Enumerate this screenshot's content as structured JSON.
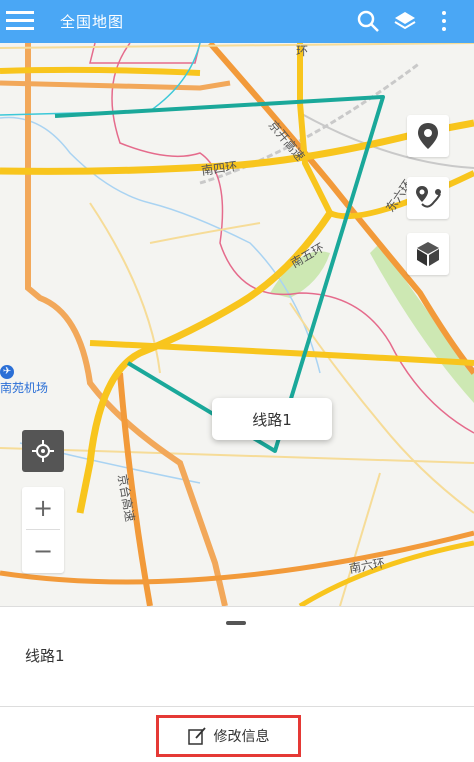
{
  "topbar": {
    "title": "全国地图",
    "icons": [
      "menu-icon",
      "search-icon",
      "layers-icon",
      "more-icon"
    ],
    "color": "#4aa7f5"
  },
  "map": {
    "labels": {
      "huan_top": "环",
      "jingkai": "京开高速",
      "nansihuan": "南四环",
      "nanwuhuan": "南五环",
      "dongliuhuan": "东六环",
      "jingtai": "京台高速",
      "nanliuhuan": "南六环"
    },
    "airport_label": "南苑机场",
    "callout_label": "线路1",
    "route_color": "#1aa89a",
    "side_icons": [
      "location-pin-icon",
      "route-pin-icon",
      "cube-icon"
    ],
    "locate_icon": "crosshair-icon",
    "zoom_in": "+",
    "zoom_out": "−"
  },
  "panel": {
    "route_name": "线路1"
  },
  "bottom": {
    "edit_label": "修改信息",
    "edit_icon": "edit-icon",
    "highlight_color": "#e53935"
  }
}
